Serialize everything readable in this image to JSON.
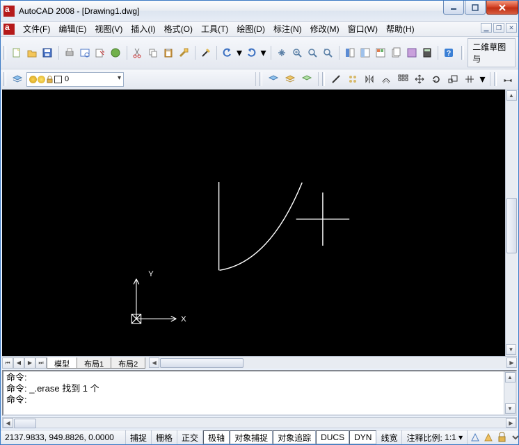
{
  "window": {
    "title": "AutoCAD 2008 - [Drawing1.dwg]"
  },
  "menu": {
    "items": [
      "文件(F)",
      "编辑(E)",
      "视图(V)",
      "插入(I)",
      "格式(O)",
      "工具(T)",
      "绘图(D)",
      "标注(N)",
      "修改(M)",
      "窗口(W)",
      "帮助(H)"
    ]
  },
  "toolbar1": {
    "right_label": "二维草图与"
  },
  "layer": {
    "name": "0"
  },
  "layout_tabs": [
    "模型",
    "布局1",
    "布局2"
  ],
  "command": {
    "line1": "命令:",
    "line2": "命令: _.erase 找到 1 个",
    "line3": "命令:"
  },
  "status": {
    "coords": "2137.9833, 949.8826, 0.0000",
    "toggles": [
      "捕捉",
      "栅格",
      "正交",
      "极轴",
      "对象捕捉",
      "对象追踪",
      "DUCS",
      "DYN",
      "线宽"
    ],
    "active_toggles": [
      "极轴",
      "对象捕捉",
      "对象追踪",
      "DUCS",
      "DYN"
    ],
    "annoscale_label": "注释比例:",
    "annoscale_value": "1:1"
  },
  "ucs": {
    "x": "X",
    "y": "Y"
  }
}
